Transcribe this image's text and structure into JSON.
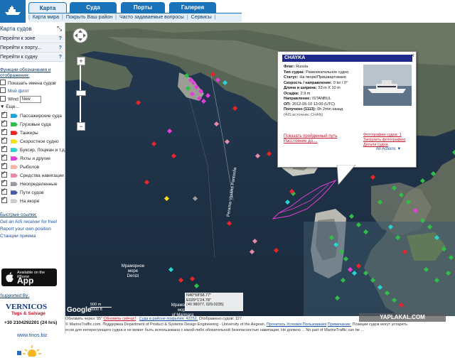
{
  "header": {
    "tabs": [
      {
        "label": "Карта",
        "active": true
      },
      {
        "label": "Суда",
        "active": false
      },
      {
        "label": "Порты",
        "active": false
      },
      {
        "label": "Галерея",
        "active": false
      }
    ],
    "subnav": [
      "Карта мира",
      "Покрыть Ваш район",
      "Часто задаваемые вопросы",
      "Сервисы"
    ]
  },
  "sidebar": {
    "title": "Карта судов",
    "nav": [
      {
        "label": "Перейти к зоне",
        "help": "?"
      },
      {
        "label": "Перейти к порту...",
        "help": "?"
      },
      {
        "label": "Перейти к судну",
        "help": "?"
      }
    ],
    "functions_title": "Функции обозначения и отображения:",
    "options": [
      {
        "label": "Показать имена судов",
        "checked": false
      },
      {
        "label": "Мой флот",
        "checked": false
      },
      {
        "label": "Wind",
        "checked": false,
        "select": "New"
      }
    ],
    "more": "Еще...",
    "legend": [
      {
        "label": "Пассажирские суда",
        "color": "#1aa6d8",
        "checked": true
      },
      {
        "label": "Грузовые суда",
        "color": "#2fbf48",
        "checked": true
      },
      {
        "label": "Танкеры",
        "color": "#e8262a",
        "checked": true
      },
      {
        "label": "Скоростное судно",
        "color": "#f5e020",
        "checked": true
      },
      {
        "label": "Буксир, Лоцман и т.д.",
        "color": "#2ad2d2",
        "checked": true
      },
      {
        "label": "Яхты и другие",
        "color": "#e23fd6",
        "checked": true
      },
      {
        "label": "Рыболов",
        "color": "#f2b6a8",
        "checked": true
      },
      {
        "label": "Средства навигации",
        "color": "#e88aa8",
        "checked": true
      },
      {
        "label": "Неопределенные",
        "color": "#9a9aa0",
        "checked": true
      },
      {
        "label": "Пути судов",
        "color": "#4a5ca8",
        "checked": true
      },
      {
        "label": "На якоре",
        "color": "#cccccc",
        "checked": true
      }
    ],
    "quick_links_title": "Быстрые ссылки:",
    "quick_links": [
      "Get an AIS receiver for free!",
      "Report your own position",
      "Станции приема"
    ],
    "app_store": {
      "small": "Available on the iPhone",
      "big": "App Store"
    },
    "supported_by": "Supported By:",
    "sponsor": {
      "name": "VERNICOS",
      "sub": "Tugs & Salvage",
      "phone": "+30 2104292201 (24 hrs)",
      "url": "www.tinos.biz"
    }
  },
  "map": {
    "labels": {
      "road1": "Perama-Vasilika Pantoolla",
      "place1": "Мраморное\nморе\nDenizi",
      "place2": "Мраморное\nморе\nof Marmara"
    },
    "coords": {
      "line1": "N40°58'58.77\"",
      "line2": "E029°1'24.78\"",
      "line3": "(40.98077, 029.0235)"
    },
    "scale": {
      "top": "500 m",
      "bottom": "2000 ft"
    },
    "google": "Google",
    "zoom_in": "+",
    "zoom_out": "−"
  },
  "popup": {
    "name": "CHAYKA",
    "fields": [
      {
        "k": "Флаг:",
        "v": "Russia"
      },
      {
        "k": "Тип судна:",
        "v": "Развлекательное судно"
      },
      {
        "k": "Статус:",
        "v": "На якоре/Пришвартовано"
      },
      {
        "k": "Скорость / направление:",
        "v": "0 kn / 0°"
      },
      {
        "k": "Длина и ширина:",
        "v": "53 m X 10 m"
      },
      {
        "k": "Осадка:",
        "v": "2.9 m"
      },
      {
        "k": "Направление:",
        "v": "ISTANBUL"
      },
      {
        "k": "ОП:",
        "v": "2012-05-10 13:00 (UTC)"
      },
      {
        "k": "Получено (1113):",
        "v": "0h 2min назад"
      }
    ],
    "via": "(АIS источник: CHAN)",
    "link_track": "Показать пройденный путь",
    "link_distance": "Расстояние до....",
    "photos_label": "Фотографии судна: 1",
    "upload": "Загрузить фотографию",
    "details": "Детали судна",
    "actions": "All Actions"
  },
  "footer": {
    "line1": [
      "Обновить через: 95\"",
      "Обновить сейчас!",
      "Суда в районе покрытия: 42252.",
      "Отображено судов: 127."
    ],
    "line2": [
      "© MarineTraffic.com. Поддержка Department of Product & Systems Design Engineering - University of the Aegean.",
      "Прочитать Условия Пользования",
      "Примечание:",
      "Позиции судов могут устареть"
    ],
    "line3": "если для интересующего судна и не может быть использована с какой-либо обязательной безопасностью навигации. Не должно ... No part of MarineTraffic can be ..."
  },
  "watermark": "YAPLAKAL.COM"
}
